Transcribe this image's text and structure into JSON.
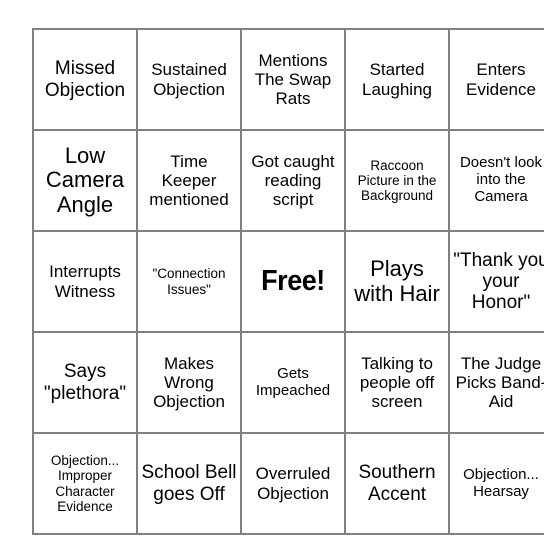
{
  "card": {
    "type": "bingo-card",
    "columns": 5,
    "rows": 5,
    "border_color": "#808080",
    "background_color": "#ffffff",
    "text_color": "#000000",
    "cells": [
      {
        "text": "Missed Objection",
        "size": "lg",
        "free": false
      },
      {
        "text": "Sustained Objection",
        "size": "md",
        "free": false
      },
      {
        "text": "Mentions The Swap Rats",
        "size": "md",
        "free": false
      },
      {
        "text": "Started Laughing",
        "size": "md",
        "free": false
      },
      {
        "text": "Enters Evidence",
        "size": "md",
        "free": false
      },
      {
        "text": "Low Camera Angle",
        "size": "xl",
        "free": false
      },
      {
        "text": "Time Keeper mentioned",
        "size": "md",
        "free": false
      },
      {
        "text": "Got caught reading script",
        "size": "md",
        "free": false
      },
      {
        "text": "Raccoon Picture in the Background",
        "size": "xs",
        "free": false
      },
      {
        "text": "Doesn't look into the Camera",
        "size": "sm",
        "free": false
      },
      {
        "text": "Interrupts Witness",
        "size": "md",
        "free": false
      },
      {
        "text": "\"Connection Issues\"",
        "size": "xs",
        "free": false
      },
      {
        "text": "Free!",
        "size": "free",
        "free": true
      },
      {
        "text": "Plays with Hair",
        "size": "xl",
        "free": false
      },
      {
        "text": "\"Thank you your Honor\"",
        "size": "lg",
        "free": false
      },
      {
        "text": "Says \"plethora\"",
        "size": "lg",
        "free": false
      },
      {
        "text": "Makes Wrong Objection",
        "size": "md",
        "free": false
      },
      {
        "text": "Gets Impeached",
        "size": "sm",
        "free": false
      },
      {
        "text": "Talking to people off screen",
        "size": "md",
        "free": false
      },
      {
        "text": "The Judge Picks Band-Aid",
        "size": "md",
        "free": false
      },
      {
        "text": "Objection... Improper Character Evidence",
        "size": "xs",
        "free": false
      },
      {
        "text": "School Bell goes Off",
        "size": "lg",
        "free": false
      },
      {
        "text": "Overruled Objection",
        "size": "md",
        "free": false
      },
      {
        "text": "Southern Accent",
        "size": "lg",
        "free": false
      },
      {
        "text": "Objection... Hearsay",
        "size": "sm",
        "free": false
      }
    ]
  }
}
